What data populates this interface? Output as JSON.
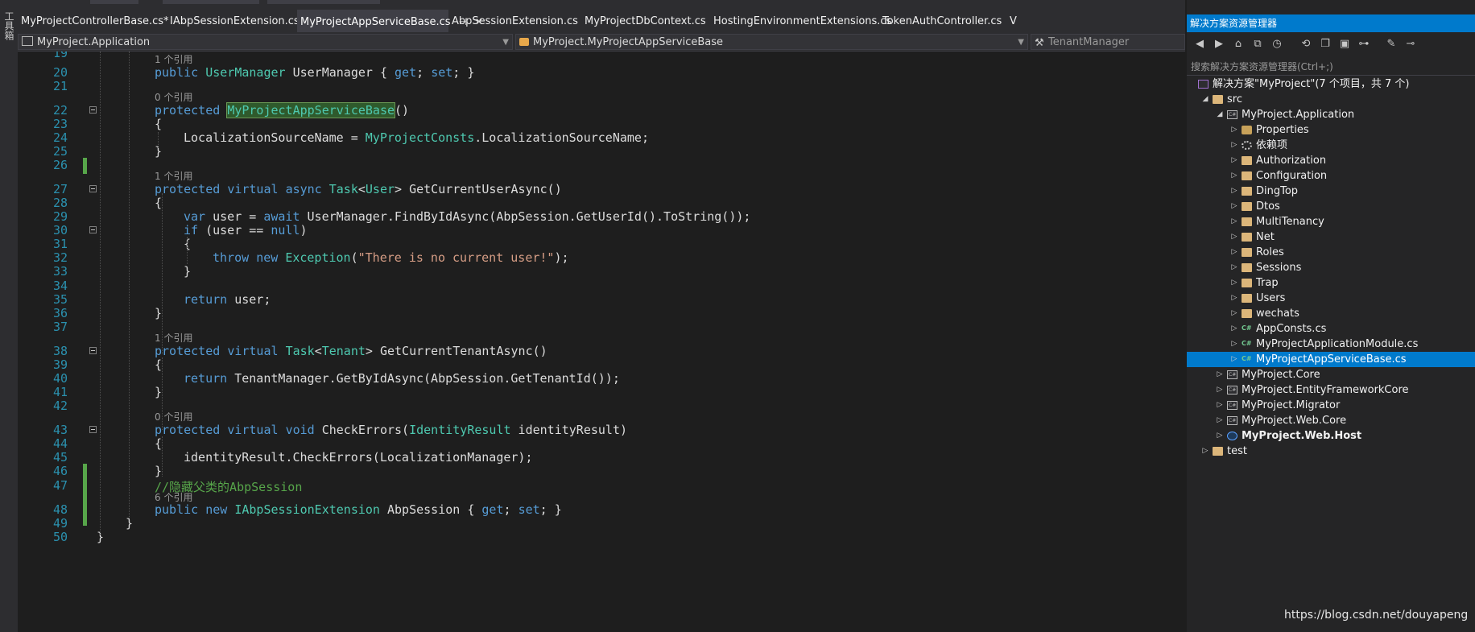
{
  "toolbox": {
    "label": "工具箱"
  },
  "tabs": [
    {
      "label": "MyProjectControllerBase.cs*",
      "active": false
    },
    {
      "label": "IAbpSessionExtension.cs",
      "active": false
    },
    {
      "label": "MyProjectAppServiceBase.cs",
      "active": true,
      "pin": "⊣",
      "close": "✕"
    },
    {
      "label": "AbpSessionExtension.cs",
      "active": false
    },
    {
      "label": "MyProjectDbContext.cs",
      "active": false
    },
    {
      "label": "HostingEnvironmentExtensions.cs",
      "active": false
    },
    {
      "label": "TokenAuthController.cs",
      "active": false
    },
    {
      "label": "V",
      "active": false
    }
  ],
  "navbar": {
    "project": "MyProject.Application",
    "class": "MyProject.MyProjectAppServiceBase",
    "member": "TenantManager"
  },
  "code": {
    "lines": [
      {
        "n": "19",
        "code": ""
      },
      {
        "n": "20",
        "lens": "1 个引用",
        "code": ""
      },
      {
        "n": "21",
        "code": ""
      },
      {
        "n": "22",
        "lens": "0 个引用",
        "code": ""
      },
      {
        "n": "23",
        "code": "{"
      },
      {
        "n": "24",
        "code": ""
      },
      {
        "n": "25",
        "code": "}"
      },
      {
        "n": "26",
        "code": ""
      },
      {
        "n": "27",
        "lens": "1 个引用",
        "code": ""
      },
      {
        "n": "28",
        "code": "{"
      },
      {
        "n": "29",
        "code": ""
      },
      {
        "n": "30",
        "code": ""
      },
      {
        "n": "31",
        "code": "{"
      },
      {
        "n": "32",
        "code": ""
      },
      {
        "n": "33",
        "code": "}"
      },
      {
        "n": "34",
        "code": ""
      },
      {
        "n": "35",
        "code": ""
      },
      {
        "n": "36",
        "code": "}"
      },
      {
        "n": "37",
        "code": ""
      },
      {
        "n": "38",
        "lens": "1 个引用",
        "code": ""
      },
      {
        "n": "39",
        "code": "{"
      },
      {
        "n": "40",
        "code": ""
      },
      {
        "n": "41",
        "code": "}"
      },
      {
        "n": "42",
        "code": ""
      },
      {
        "n": "43",
        "lens": "0 个引用",
        "code": ""
      },
      {
        "n": "44",
        "code": "{"
      },
      {
        "n": "45",
        "code": ""
      },
      {
        "n": "46",
        "code": "}"
      },
      {
        "n": "47",
        "code": ""
      },
      {
        "n": "48",
        "lens": "6 个引用",
        "code": ""
      },
      {
        "n": "49",
        "code": "}"
      },
      {
        "n": "50",
        "code": "}"
      }
    ],
    "tokens": {
      "l20_public": "public",
      "l20_type": "UserManager",
      "l20_rest": " UserManager { ",
      "l20_get": "get",
      "l20_semi": "; ",
      "l20_set": "set",
      "l20_end": "; }",
      "l22_prot": "protected",
      "l22_ctor": "MyProjectAppServiceBase",
      "l22_end": "()",
      "l24_a": "LocalizationSourceName = ",
      "l24_type": "MyProjectConsts",
      "l24_b": ".LocalizationSourceName;",
      "l27_prot": "protected",
      "l27_virt": "virtual",
      "l27_async": "async",
      "l27_task": "Task",
      "l27_lt": "<",
      "l27_user": "User",
      "l27_rest": "> GetCurrentUserAsync()",
      "l29_var": "var",
      "l29_a": " user = ",
      "l29_await": "await",
      "l29_b": " UserManager.FindByIdAsync(AbpSession.GetUserId().ToString());",
      "l30_if": "if",
      "l30_a": " (user == ",
      "l30_null": "null",
      "l30_b": ")",
      "l32_throw": "throw",
      "l32_new": "new",
      "l32_exc": "Exception",
      "l32_a": "(",
      "l32_str": "\"There is no current user!\"",
      "l32_b": ");",
      "l35_ret": "return",
      "l35_a": " user;",
      "l38_prot": "protected",
      "l38_virt": "virtual",
      "l38_task": "Task",
      "l38_lt": "<",
      "l38_tenant": "Tenant",
      "l38_rest": "> GetCurrentTenantAsync()",
      "l40_ret": "return",
      "l40_a": " TenantManager.GetByIdAsync(AbpSession.GetTenantId());",
      "l43_prot": "protected",
      "l43_virt": "virtual",
      "l43_void": "void",
      "l43_a": " CheckErrors(",
      "l43_type": "IdentityResult",
      "l43_b": " identityResult)",
      "l45_a": "identityResult.CheckErrors(LocalizationManager);",
      "l47_cm": "//隐藏父类的AbpSession",
      "l48_public": "public",
      "l48_new": "new",
      "l48_type": "IAbpSessionExtension",
      "l48_a": " AbpSession { ",
      "l48_get": "get",
      "l48_semi": "; ",
      "l48_set": "set",
      "l48_end": "; }"
    }
  },
  "solution": {
    "title": "解决方案资源管理器",
    "search_placeholder": "搜索解决方案资源管理器(Ctrl+;)",
    "toolbar_icons": [
      "back-icon",
      "forward-icon",
      "home-icon",
      "sync-view-icon",
      "pending-changes-icon",
      "refresh-icon",
      "collapse-all-icon",
      "show-all-files-icon",
      "view-class-icon",
      "properties-icon",
      "preview-icon"
    ],
    "toolbar_glyphs": [
      "◀",
      "▶",
      "⌂",
      "⧉",
      "◷",
      "⟲",
      "❐",
      "▣",
      "⊶",
      "✎",
      "⊸"
    ],
    "nodes": [
      {
        "label": "解决方案\"MyProject\"(7 个项目，共 7 个)",
        "depth": 0,
        "icon": "sol",
        "twisty": "",
        "name": "solution-root"
      },
      {
        "label": "src",
        "depth": 1,
        "icon": "folder",
        "twisty": "◢",
        "name": "tree-folder-src"
      },
      {
        "label": "MyProject.Application",
        "depth": 2,
        "icon": "proj",
        "twisty": "◢",
        "name": "tree-project-application"
      },
      {
        "label": "Properties",
        "depth": 3,
        "icon": "props",
        "twisty": "▷",
        "name": "tree-item-properties"
      },
      {
        "label": "依赖项",
        "depth": 3,
        "icon": "dep",
        "twisty": "▷",
        "name": "tree-item-dependencies"
      },
      {
        "label": "Authorization",
        "depth": 3,
        "icon": "folder",
        "twisty": "▷",
        "name": "tree-folder-authorization"
      },
      {
        "label": "Configuration",
        "depth": 3,
        "icon": "folder",
        "twisty": "▷",
        "name": "tree-folder-configuration"
      },
      {
        "label": "DingTop",
        "depth": 3,
        "icon": "folder",
        "twisty": "▷",
        "name": "tree-folder-dingtop"
      },
      {
        "label": "Dtos",
        "depth": 3,
        "icon": "folder",
        "twisty": "▷",
        "name": "tree-folder-dtos"
      },
      {
        "label": "MultiTenancy",
        "depth": 3,
        "icon": "folder",
        "twisty": "▷",
        "name": "tree-folder-multitenancy"
      },
      {
        "label": "Net",
        "depth": 3,
        "icon": "folder",
        "twisty": "▷",
        "name": "tree-folder-net"
      },
      {
        "label": "Roles",
        "depth": 3,
        "icon": "folder",
        "twisty": "▷",
        "name": "tree-folder-roles"
      },
      {
        "label": "Sessions",
        "depth": 3,
        "icon": "folder",
        "twisty": "▷",
        "name": "tree-folder-sessions"
      },
      {
        "label": "Trap",
        "depth": 3,
        "icon": "folder",
        "twisty": "▷",
        "name": "tree-folder-trap"
      },
      {
        "label": "Users",
        "depth": 3,
        "icon": "folder",
        "twisty": "▷",
        "name": "tree-folder-users"
      },
      {
        "label": "wechats",
        "depth": 3,
        "icon": "folder",
        "twisty": "▷",
        "name": "tree-folder-wechats"
      },
      {
        "label": "AppConsts.cs",
        "depth": 3,
        "icon": "csfile",
        "twisty": "▷",
        "name": "tree-file-appconsts"
      },
      {
        "label": "MyProjectApplicationModule.cs",
        "depth": 3,
        "icon": "csfile",
        "twisty": "▷",
        "name": "tree-file-applicationmodule"
      },
      {
        "label": "MyProjectAppServiceBase.cs",
        "depth": 3,
        "icon": "csfile",
        "twisty": "▷",
        "name": "tree-file-appservicebase",
        "selected": true
      },
      {
        "label": "MyProject.Core",
        "depth": 2,
        "icon": "proj",
        "twisty": "▷",
        "name": "tree-project-core"
      },
      {
        "label": "MyProject.EntityFrameworkCore",
        "depth": 2,
        "icon": "proj",
        "twisty": "▷",
        "name": "tree-project-efcore"
      },
      {
        "label": "MyProject.Migrator",
        "depth": 2,
        "icon": "proj",
        "twisty": "▷",
        "name": "tree-project-migrator"
      },
      {
        "label": "MyProject.Web.Core",
        "depth": 2,
        "icon": "proj",
        "twisty": "▷",
        "name": "tree-project-webcore"
      },
      {
        "label": "MyProject.Web.Host",
        "depth": 2,
        "icon": "web",
        "twisty": "▷",
        "name": "tree-project-webhost",
        "bold": true
      },
      {
        "label": "test",
        "depth": 1,
        "icon": "folder",
        "twisty": "▷",
        "name": "tree-folder-test"
      }
    ]
  },
  "watermark": "https://blog.csdn.net/douyapeng"
}
